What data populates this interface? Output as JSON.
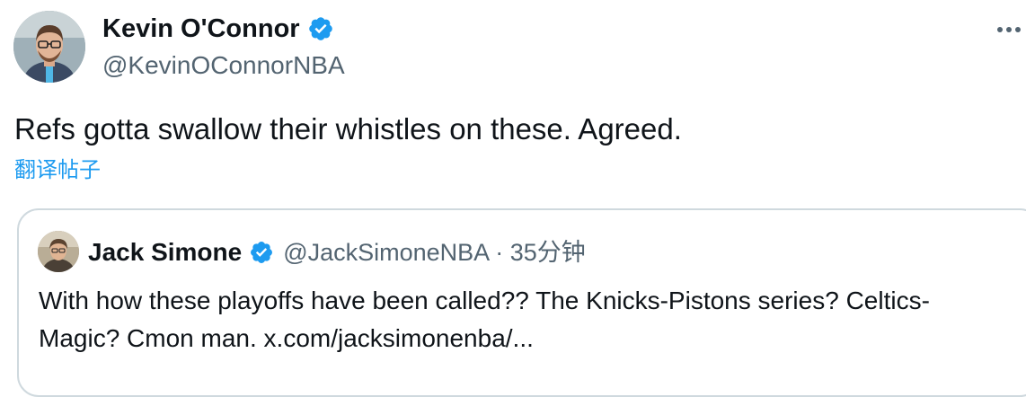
{
  "tweet": {
    "author_name": "Kevin O'Connor",
    "author_handle": "@KevinOConnorNBA",
    "text": "Refs gotta swallow their whistles on these. Agreed.",
    "translate_label": "翻译帖子",
    "more_icon": "more-horizontal-icon",
    "verified_icon": "verified-badge-icon"
  },
  "quoted_tweet": {
    "author_name": "Jack Simone",
    "meta": "@JackSimoneNBA · 35分钟",
    "text": "With how these playoffs have been called?? The Knicks-Pistons series? Celtics-Magic? Cmon man.  x.com/jacksimonenba/..."
  },
  "colors": {
    "verified": "#1d9bf0",
    "link": "#1d9bf0",
    "secondary_text": "#536471",
    "border": "#cfd9de"
  }
}
